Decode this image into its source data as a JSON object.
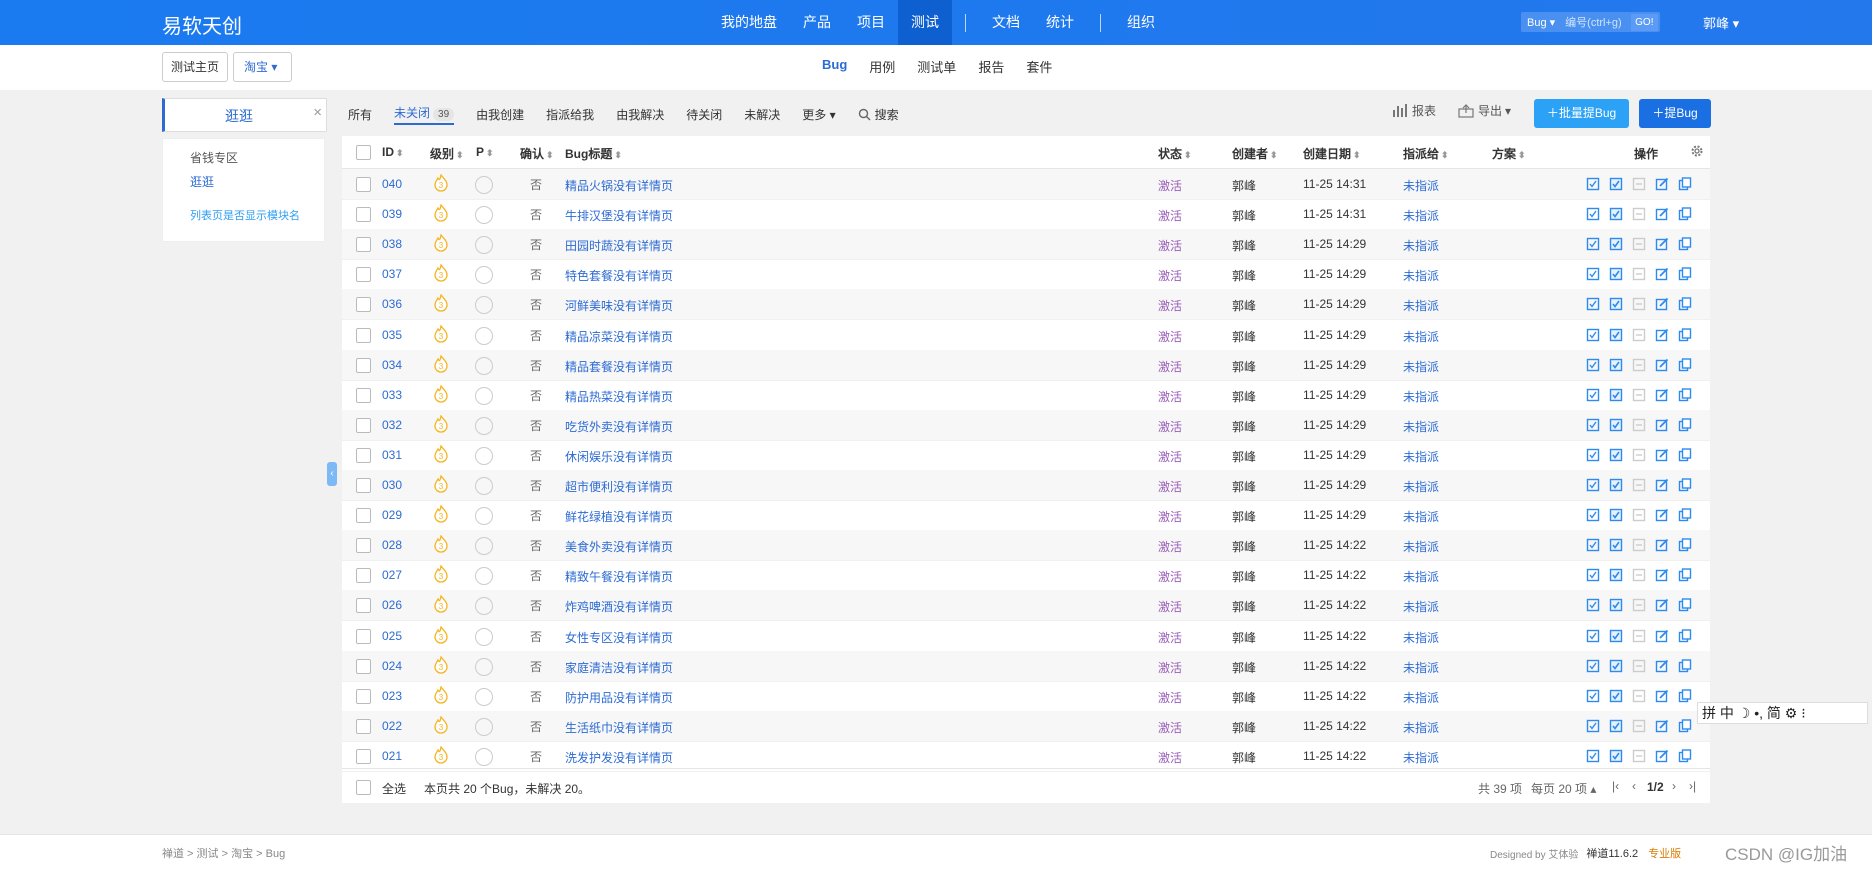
{
  "app": {
    "brand": "易软天创"
  },
  "topnav": {
    "items": [
      "我的地盘",
      "产品",
      "项目",
      "测试",
      "文档",
      "统计",
      "组织"
    ],
    "active": "测试"
  },
  "top_search": {
    "type": "Bug",
    "placeholder": "编号(ctrl+g)",
    "go": "GO!"
  },
  "user": {
    "name": "郭峰"
  },
  "breadcrumb": {
    "home": "测试主页",
    "product": "淘宝"
  },
  "subnav": {
    "items": [
      "Bug",
      "用例",
      "测试单",
      "报告",
      "套件"
    ],
    "active": "Bug"
  },
  "module_box": {
    "title": "逛逛",
    "close": "×"
  },
  "tree": {
    "item1": "省钱专区",
    "item2": "逛逛",
    "hint": "列表页是否显示模块名"
  },
  "filters": {
    "all": "所有",
    "unclosed": "未关闭",
    "unclosed_count": "39",
    "created": "由我创建",
    "assigned": "指派给我",
    "resolved": "由我解决",
    "toclose": "待关闭",
    "unresolved": "未解决",
    "more": "更多",
    "search": "搜索"
  },
  "toolbar": {
    "report": "报表",
    "export": "导出",
    "batch": "批量提Bug",
    "add": "提Bug"
  },
  "table": {
    "headers": {
      "id": "ID",
      "severity": "级别",
      "pri": "P",
      "confirm": "确认",
      "title": "Bug标题",
      "status": "状态",
      "creator": "创建者",
      "created": "创建日期",
      "assigned": "指派给",
      "resolution": "方案",
      "actions": "操作"
    },
    "rows": [
      {
        "id": "040",
        "title": "精品火锅没有详情页",
        "date": "11-25 14:31"
      },
      {
        "id": "039",
        "title": "牛排汉堡没有详情页",
        "date": "11-25 14:31"
      },
      {
        "id": "038",
        "title": "田园时蔬没有详情页",
        "date": "11-25 14:29"
      },
      {
        "id": "037",
        "title": "特色套餐没有详情页",
        "date": "11-25 14:29"
      },
      {
        "id": "036",
        "title": "河鲜美味没有详情页",
        "date": "11-25 14:29"
      },
      {
        "id": "035",
        "title": "精品凉菜没有详情页",
        "date": "11-25 14:29"
      },
      {
        "id": "034",
        "title": "精品套餐没有详情页",
        "date": "11-25 14:29"
      },
      {
        "id": "033",
        "title": "精品热菜没有详情页",
        "date": "11-25 14:29"
      },
      {
        "id": "032",
        "title": "吃货外卖没有详情页",
        "date": "11-25 14:29"
      },
      {
        "id": "031",
        "title": "休闲娱乐没有详情页",
        "date": "11-25 14:29"
      },
      {
        "id": "030",
        "title": "超市便利没有详情页",
        "date": "11-25 14:29"
      },
      {
        "id": "029",
        "title": "鲜花绿植没有详情页",
        "date": "11-25 14:29"
      },
      {
        "id": "028",
        "title": "美食外卖没有详情页",
        "date": "11-25 14:22"
      },
      {
        "id": "027",
        "title": "精致午餐没有详情页",
        "date": "11-25 14:22"
      },
      {
        "id": "026",
        "title": "炸鸡啤酒没有详情页",
        "date": "11-25 14:22"
      },
      {
        "id": "025",
        "title": "女性专区没有详情页",
        "date": "11-25 14:22"
      },
      {
        "id": "024",
        "title": "家庭清洁没有详情页",
        "date": "11-25 14:22"
      },
      {
        "id": "023",
        "title": "防护用品没有详情页",
        "date": "11-25 14:22"
      },
      {
        "id": "022",
        "title": "生活纸巾没有详情页",
        "date": "11-25 14:22"
      },
      {
        "id": "021",
        "title": "洗发护发没有详情页",
        "date": "11-25 14:22"
      }
    ],
    "row_defaults": {
      "confirm": "否",
      "status": "激活",
      "creator": "郭峰",
      "assigned": "未指派",
      "severity": "3"
    }
  },
  "footer": {
    "select_all": "全选",
    "summary": "本页共 20 个Bug，未解决 20。",
    "total": "共 39 项",
    "per_page": "每页 20 项",
    "page": "1/2"
  },
  "bottom": {
    "crumbs": "禅道 > 测试 > 淘宝 > Bug",
    "designed_by": "Designed by 艾体验",
    "version": "禅道11.6.2",
    "edition": "专业版"
  },
  "ime": {
    "text": "拼 中 ☽ •, 简 ⚙ ⁝"
  },
  "watermark": "CSDN @IG加油"
}
